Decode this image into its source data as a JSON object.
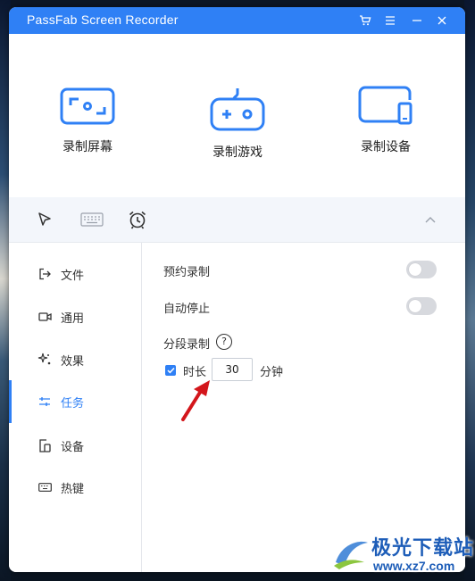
{
  "window": {
    "title": "PassFab Screen Recorder",
    "accent_color": "#2f80f5",
    "titlebar_buttons": [
      "cart-icon",
      "menu-icon",
      "minimize-icon",
      "close-icon"
    ]
  },
  "modes": [
    {
      "label": "录制屏幕",
      "icon": "screen-record-icon"
    },
    {
      "label": "录制游戏",
      "icon": "gamepad-icon"
    },
    {
      "label": "录制设备",
      "icon": "device-icon"
    }
  ],
  "toolbar": {
    "tools": [
      "cursor-icon",
      "keyboard-icon",
      "alarm-clock-icon"
    ],
    "collapse": "chevron-up-icon"
  },
  "sidebar": {
    "items": [
      {
        "label": "文件",
        "icon": "export-icon",
        "active": false
      },
      {
        "label": "通用",
        "icon": "camera-icon",
        "active": false
      },
      {
        "label": "效果",
        "icon": "sparkle-icon",
        "active": false
      },
      {
        "label": "任务",
        "icon": "sliders-icon",
        "active": true
      },
      {
        "label": "设备",
        "icon": "devices-icon",
        "active": false
      },
      {
        "label": "热键",
        "icon": "keyboard-icon",
        "active": false
      }
    ]
  },
  "task_settings": {
    "scheduled_recording": {
      "label": "预约录制",
      "enabled": false
    },
    "auto_stop": {
      "label": "自动停止",
      "enabled": false
    },
    "segment_recording": {
      "label": "分段录制",
      "help": "?",
      "duration_checked": true,
      "duration_label": "时长",
      "duration_value": "30",
      "unit": "分钟"
    }
  },
  "watermark": {
    "name": "极光下载站",
    "url": "www.xz7.com"
  }
}
